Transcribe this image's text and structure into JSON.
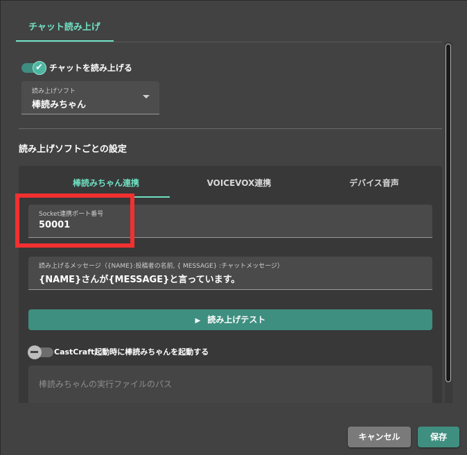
{
  "top_tab": {
    "label": "チャット読み上げ"
  },
  "read_toggle": {
    "label": "チャットを読み上げる",
    "checked": true
  },
  "soft_select": {
    "label": "読み上げソフト",
    "value": "棒読みちゃん"
  },
  "section": {
    "title": "読み上げソフトごとの設定"
  },
  "sub_tabs": [
    {
      "label": "棒読みちゃん連携",
      "active": true
    },
    {
      "label": "VOICEVOX連携",
      "active": false
    },
    {
      "label": "デバイス音声",
      "active": false
    }
  ],
  "port_field": {
    "label": "Socket連携ポート番号",
    "value": "50001"
  },
  "message_field": {
    "label": "読み上げるメッセージ（{NAME}:投稿者の名前, { MESSAGE} :チャットメッセージ）",
    "value": "{NAME}さんが{MESSAGE}と言っています。"
  },
  "test_button": {
    "label": "読み上げテスト",
    "icon": "play-icon"
  },
  "launch_toggle": {
    "label": "CastCraft起動時に棒読みちゃんを起動する",
    "checked": false
  },
  "path_field": {
    "placeholder": "棒読みちゃんの実行ファイルのパス"
  },
  "footer": {
    "cancel_label": "キャンセル",
    "save_label": "保存"
  },
  "colors": {
    "accent": "#6fe0c3",
    "button": "#3f8f80",
    "highlight": "#f23030"
  }
}
